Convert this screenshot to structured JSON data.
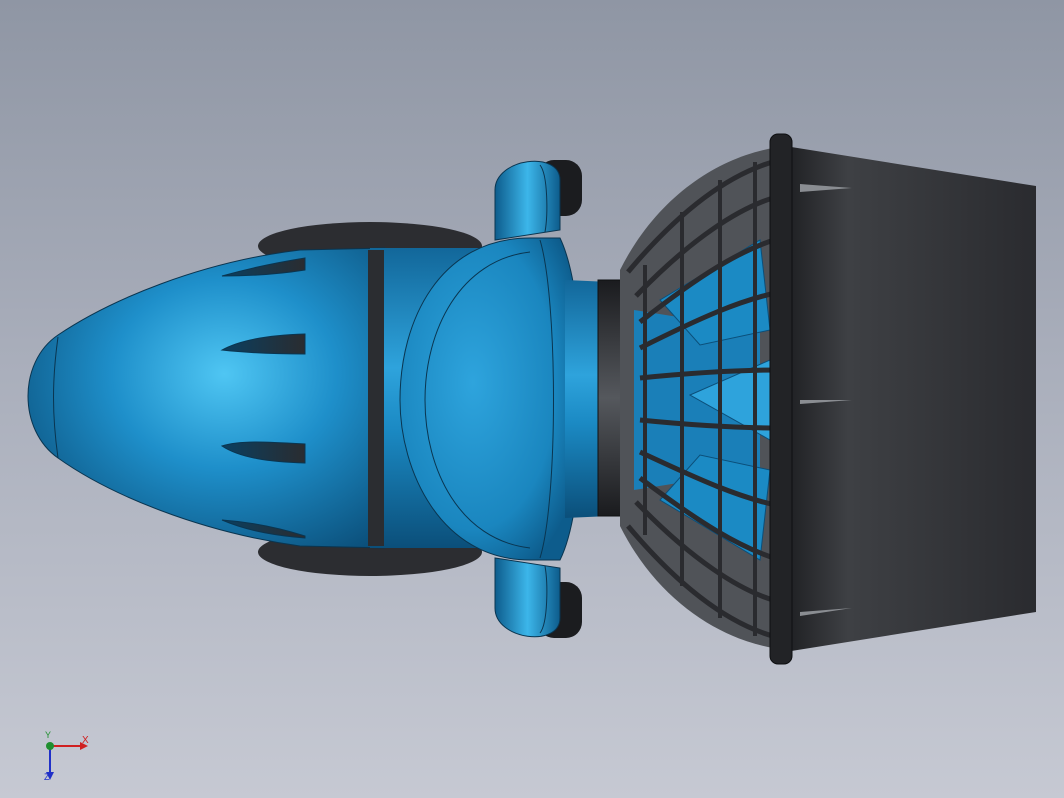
{
  "viewport": {
    "background_top": "#8f96a4",
    "background_bottom": "#c6c9d3"
  },
  "model": {
    "body_color": "#1b8ac4",
    "highlight_color": "#46bff0",
    "shadow_color": "#0b4f7a",
    "dark_part_color": "#2a2c30",
    "shroud_color": "#3a3c40"
  },
  "triad": {
    "x_label": "X",
    "y_label": "Y",
    "z_label": "Z",
    "x_color": "#d02020",
    "y_color": "#1f8f2f",
    "z_color": "#2030c8"
  }
}
